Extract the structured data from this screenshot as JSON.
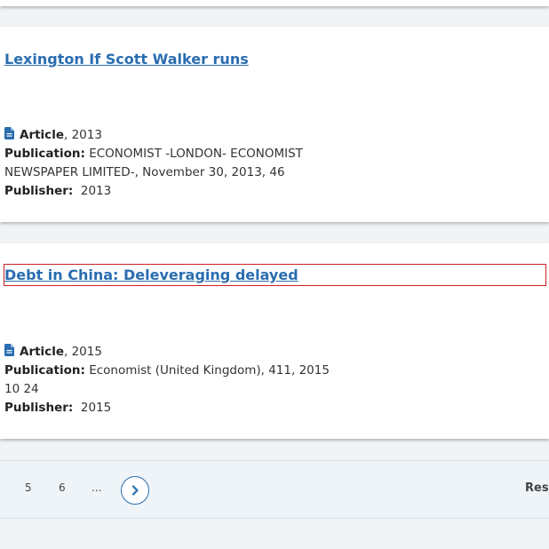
{
  "results": [
    {
      "title": "Lexington If Scott Walker runs",
      "type_label": "Article",
      "year_suffix": ", 2013",
      "publication_label": "Publication:",
      "publication_value": " ECONOMIST -LONDON- ECONOMIST NEWSPAPER LIMITED-, November 30, 2013, 46",
      "publisher_label": "Publisher:",
      "publisher_value": "  2013"
    },
    {
      "title": "Debt in China: Deleveraging delayed",
      "type_label": "Article",
      "year_suffix": ", 2015",
      "publication_label": "Publication:",
      "publication_value": " Economist (United Kingdom), 411, 2015 10 24",
      "publisher_label": "Publisher:",
      "publisher_value": "  2015"
    }
  ],
  "pagination": {
    "pages": [
      "5",
      "6",
      "..."
    ],
    "right_label": "Res"
  },
  "colors": {
    "link": "#2a6db0",
    "focus_outline": "#cc2222"
  },
  "icons": {
    "document": "document-icon",
    "next": "chevron-right-icon"
  }
}
